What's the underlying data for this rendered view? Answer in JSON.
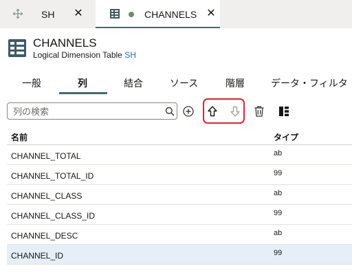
{
  "tabs": [
    {
      "label": "SH",
      "icon": "drag-move-icon"
    },
    {
      "label": "CHANNELS",
      "icon": "table-icon",
      "modified": true
    }
  ],
  "header": {
    "title": "CHANNELS",
    "subtitle_prefix": "Logical Dimension Table",
    "subtitle_link": "SH"
  },
  "section_tabs": [
    "一般",
    "列",
    "結合",
    "ソース",
    "階層",
    "データ・フィルタ"
  ],
  "active_section": "列",
  "search": {
    "placeholder": "列の検索",
    "value": ""
  },
  "toolbar_icons": [
    "add-icon",
    "move-up-icon",
    "move-down-icon",
    "delete-icon",
    "column-layout-icon"
  ],
  "table": {
    "columns": [
      "名前",
      "タイプ"
    ],
    "rows": [
      {
        "name": "CHANNEL_TOTAL",
        "type": "ab"
      },
      {
        "name": "CHANNEL_TOTAL_ID",
        "type": "99"
      },
      {
        "name": "CHANNEL_CLASS",
        "type": "ab"
      },
      {
        "name": "CHANNEL_CLASS_ID",
        "type": "99"
      },
      {
        "name": "CHANNEL_DESC",
        "type": "ab"
      },
      {
        "name": "CHANNEL_ID",
        "type": "99",
        "selected": true
      }
    ]
  },
  "colors": {
    "accent": "#3d6b70",
    "link": "#1f6fb2",
    "highlight": "#e3202d",
    "selected_row": "#e4eff7"
  }
}
